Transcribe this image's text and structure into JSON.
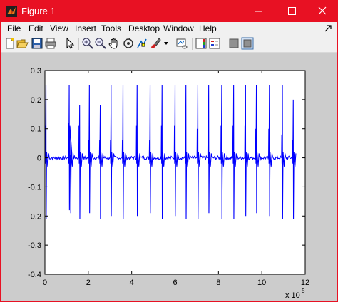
{
  "window": {
    "title": "Figure 1",
    "controls": [
      "minimize",
      "maximize",
      "close"
    ]
  },
  "menu": [
    "File",
    "Edit",
    "View",
    "Insert",
    "Tools",
    "Desktop",
    "Window",
    "Help"
  ],
  "toolbar": {
    "icons": [
      "new-figure-icon",
      "open-file-icon",
      "save-icon",
      "print-icon",
      "edit-plot-arrow-icon",
      "zoom-in-icon",
      "zoom-out-icon",
      "pan-hand-icon",
      "rotate-3d-icon",
      "data-cursor-icon",
      "brush-icon",
      "link-plot-icon",
      "insert-colorbar-icon",
      "insert-legend-icon",
      "hide-plot-tools-icon",
      "show-plot-tools-icon"
    ]
  },
  "colors": {
    "titlebar": "#e81123",
    "figure_bg": "#cccccc",
    "axes_bg": "#ffffff",
    "line": "#0000ff"
  },
  "chart_data": {
    "type": "line",
    "title": "",
    "xlabel": "",
    "ylabel": "",
    "xlim": [
      0,
      12
    ],
    "ylim": [
      -0.4,
      0.3
    ],
    "xticks": [
      "0",
      "2",
      "4",
      "6",
      "8",
      "10",
      "12"
    ],
    "yticks": [
      "-0.4",
      "-0.3",
      "-0.2",
      "-0.1",
      "0",
      "0.1",
      "0.2",
      "0.3"
    ],
    "x_exponent_label": "x 10",
    "x_exponent_power": "5",
    "grid": false,
    "baseline": 0,
    "data_range_x": [
      0,
      11.5
    ],
    "series": [
      {
        "description": "ECG-like waveform, baseline near 0 with periodic spikes",
        "beats": [
          {
            "x": 0.05,
            "peak": 0.25,
            "trough": -0.21,
            "secondary": 0.11
          },
          {
            "x": 1.12,
            "peak": 0.25,
            "trough": -0.18,
            "secondary": 0.12
          },
          {
            "x": 1.18,
            "peak": 0.01,
            "trough": -0.19,
            "secondary": 0.11
          },
          {
            "x": 1.6,
            "peak": 0.18,
            "trough": -0.21,
            "secondary": 0.11
          },
          {
            "x": 2.05,
            "peak": 0.25,
            "trough": -0.19,
            "secondary": 0.06
          },
          {
            "x": 2.55,
            "peak": 0.18,
            "trough": -0.21,
            "secondary": 0.06
          },
          {
            "x": 3.05,
            "peak": 0.25,
            "trough": -0.2,
            "secondary": 0.06
          },
          {
            "x": 3.6,
            "peak": 0.25,
            "trough": -0.21,
            "secondary": 0.06
          },
          {
            "x": 4.25,
            "peak": 0.25,
            "trough": -0.2,
            "secondary": 0.11
          },
          {
            "x": 4.85,
            "peak": 0.25,
            "trough": -0.19,
            "secondary": 0.06
          },
          {
            "x": 5.4,
            "peak": 0.25,
            "trough": -0.21,
            "secondary": 0.11
          },
          {
            "x": 6.0,
            "peak": 0.25,
            "trough": -0.2,
            "secondary": 0.11
          },
          {
            "x": 6.5,
            "peak": 0.25,
            "trough": -0.21,
            "secondary": 0.11
          },
          {
            "x": 7.05,
            "peak": 0.25,
            "trough": -0.21,
            "secondary": 0.1
          },
          {
            "x": 7.55,
            "peak": 0.25,
            "trough": -0.19,
            "secondary": 0.11
          },
          {
            "x": 8.15,
            "peak": 0.25,
            "trough": -0.21,
            "secondary": 0.11
          },
          {
            "x": 8.7,
            "peak": 0.25,
            "trough": -0.21,
            "secondary": 0.11
          },
          {
            "x": 9.25,
            "peak": 0.25,
            "trough": -0.2,
            "secondary": 0.11
          },
          {
            "x": 9.75,
            "peak": 0.25,
            "trough": -0.19,
            "secondary": 0.1
          },
          {
            "x": 10.35,
            "peak": 0.25,
            "trough": -0.2,
            "secondary": 0.1
          },
          {
            "x": 10.95,
            "peak": 0.25,
            "trough": -0.21,
            "secondary": 0.08
          },
          {
            "x": 11.45,
            "peak": 0.2,
            "trough": -0.21,
            "secondary": 0.06
          }
        ]
      }
    ]
  }
}
